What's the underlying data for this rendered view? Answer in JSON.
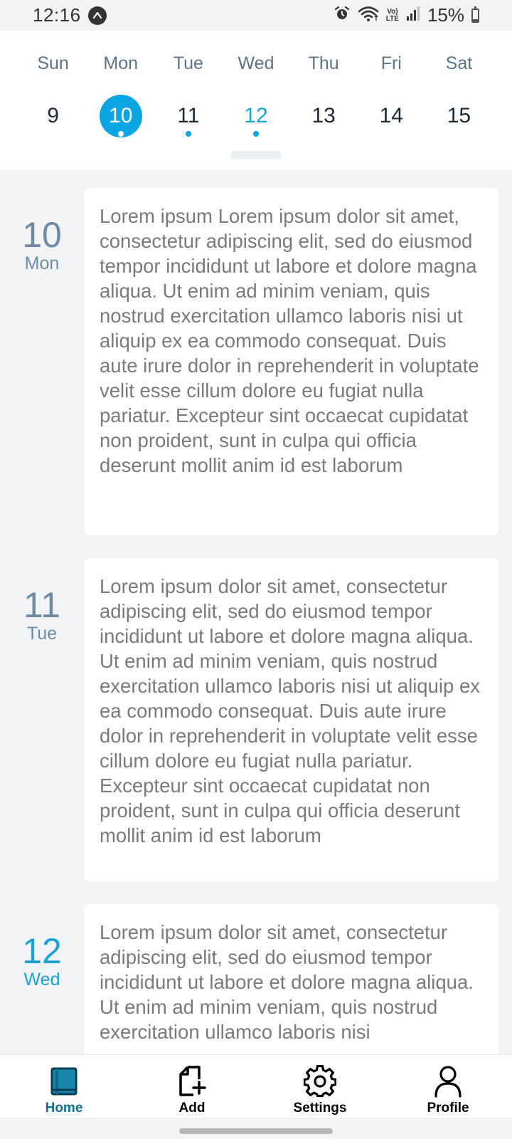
{
  "status_bar": {
    "time": "12:16",
    "lte_top": "Vo)",
    "lte_bottom": "LTE",
    "battery": "15%"
  },
  "week": {
    "day_names": [
      "Sun",
      "Mon",
      "Tue",
      "Wed",
      "Thu",
      "Fri",
      "Sat"
    ],
    "day_numbers": [
      "9",
      "10",
      "11",
      "12",
      "13",
      "14",
      "15"
    ],
    "selected_index": 1,
    "today_index": 3,
    "has_events": [
      false,
      true,
      true,
      true,
      false,
      false,
      false
    ]
  },
  "entries": [
    {
      "day_number": "10",
      "day_name": "Mon",
      "text": "Lorem ipsum Lorem ipsum dolor sit amet, consectetur adipiscing elit, sed do eiusmod tempor incididunt ut labore et dolore magna aliqua. Ut enim ad minim veniam, quis nostrud exercitation ullamco laboris nisi ut aliquip ex ea commodo consequat. Duis aute irure dolor in reprehenderit in voluptate velit esse cillum dolore eu fugiat nulla pariatur. Excepteur sint occaecat cupidatat non proident, sunt in culpa qui officia deserunt mollit anim id est laborum"
    },
    {
      "day_number": "11",
      "day_name": "Tue",
      "text": "Lorem ipsum dolor sit amet, consectetur adipiscing elit, sed do eiusmod tempor incididunt ut labore et dolore magna aliqua. Ut enim ad minim veniam, quis nostrud exercitation ullamco laboris nisi ut aliquip ex ea commodo consequat. Duis aute irure dolor in reprehenderit in voluptate velit esse cillum dolore eu fugiat nulla pariatur. Excepteur sint occaecat cupidatat non proident, sunt in culpa qui officia deserunt mollit anim id est laborum"
    },
    {
      "day_number": "12",
      "day_name": "Wed",
      "text": "Lorem ipsum dolor sit amet, consectetur adipiscing elit, sed do eiusmod tempor incididunt ut labore et dolore magna aliqua. Ut enim ad minim veniam, quis nostrud exercitation ullamco laboris nisi"
    }
  ],
  "bottom_nav": {
    "active_index": 0,
    "items": [
      {
        "label": "Home",
        "icon": "book-icon"
      },
      {
        "label": "Add",
        "icon": "add-page-icon"
      },
      {
        "label": "Settings",
        "icon": "gear-icon"
      },
      {
        "label": "Profile",
        "icon": "person-icon"
      }
    ]
  },
  "colors": {
    "accent": "#0ba5e3",
    "today_text": "#1ba3d6",
    "nav_active": "#0e6f95",
    "date_gray": "#6f8aa3"
  }
}
